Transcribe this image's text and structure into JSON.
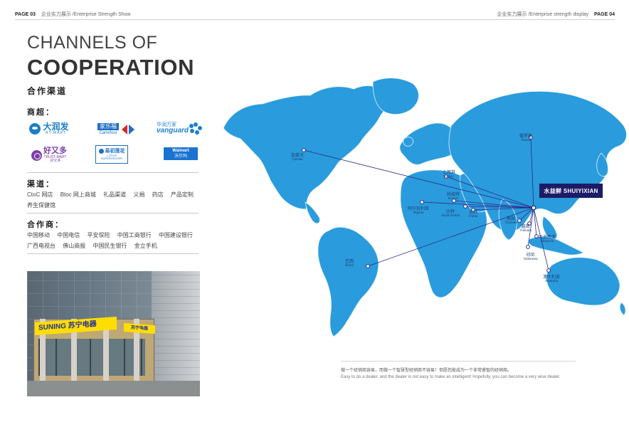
{
  "header": {
    "left_page": "PAGE 03",
    "left_text": "企业实力展示 /Enterprise Strength Show",
    "right_text": "企业实力展示 /Enterprise strength display",
    "right_page": "PAGE 04"
  },
  "title": {
    "line1": "CHANNELS OF",
    "line2": "COOPERATION",
    "cn": "合作渠道"
  },
  "sections": {
    "supermarkets": "商超：",
    "channels": "渠道：",
    "partners": "合作商："
  },
  "logos": {
    "runmart": {
      "name": "大润发",
      "sub": "RT-MART"
    },
    "carrefour": {
      "cn": "家乐福",
      "en": "Carrefour"
    },
    "vanguard": {
      "cn": "华润万家",
      "en": "vanguard"
    },
    "haoyouduo": {
      "cn": "好又多",
      "en": "TRUST-MART",
      "sub": "好又多"
    },
    "lotus": {
      "cn": "易初莲花",
      "en": "LOTUS SUPERCENTER"
    },
    "walmart": {
      "en": "Walmart",
      "cn": "沃尔玛"
    }
  },
  "channels": [
    "CtoC 网店",
    "Btoc 网上商城",
    "礼品渠道",
    "义捐",
    "药店",
    "产品定制",
    "养生保健馆"
  ],
  "partners": [
    "中国移动",
    "中国电信",
    "平安保险",
    "中国工商银行",
    "中国建设银行",
    "广西电视台",
    "佛山商报",
    "中国民生银行",
    "金立手机"
  ],
  "photo": {
    "sign_left": "SUNING 苏宁电器",
    "sign_right": "苏宁电器"
  },
  "map": {
    "hq_label": "水益鲜 SHUIYIXIAN",
    "locations": [
      {
        "cn": "加拿大",
        "en": "Canada"
      },
      {
        "cn": "俄罗斯",
        "en": "Russia"
      },
      {
        "cn": "土耳其",
        "en": "Turkey"
      },
      {
        "cn": "科威特",
        "en": "Kuwait"
      },
      {
        "cn": "阿尔及利亚",
        "en": "Algeria"
      },
      {
        "cn": "沙特",
        "en": "Saudi Arabia"
      },
      {
        "cn": "迪拜",
        "en": "Dubai"
      },
      {
        "cn": "泰国",
        "en": "Thailand"
      },
      {
        "cn": "越南",
        "en": "Vietnam"
      },
      {
        "cn": "马来西亚",
        "en": "Malaysia"
      },
      {
        "cn": "印尼",
        "en": "Indonesia"
      },
      {
        "cn": "巴西",
        "en": "Brazil"
      },
      {
        "cn": "澳大利亚",
        "en": "Australia"
      }
    ]
  },
  "slogan": {
    "cn": "做一个经销商容易，而做一个智慧型经销商不容易！但愿您能成为一个非常睿智的经销商。",
    "en": "Easy to do a dealer, and the dealer is not easy to make an intelligent! Hopefully, you can become a very wise dealer."
  },
  "colors": {
    "map_blue": "#2a9bdc",
    "line_blue": "#2c2a86",
    "hq_box": "#1d1b68"
  }
}
